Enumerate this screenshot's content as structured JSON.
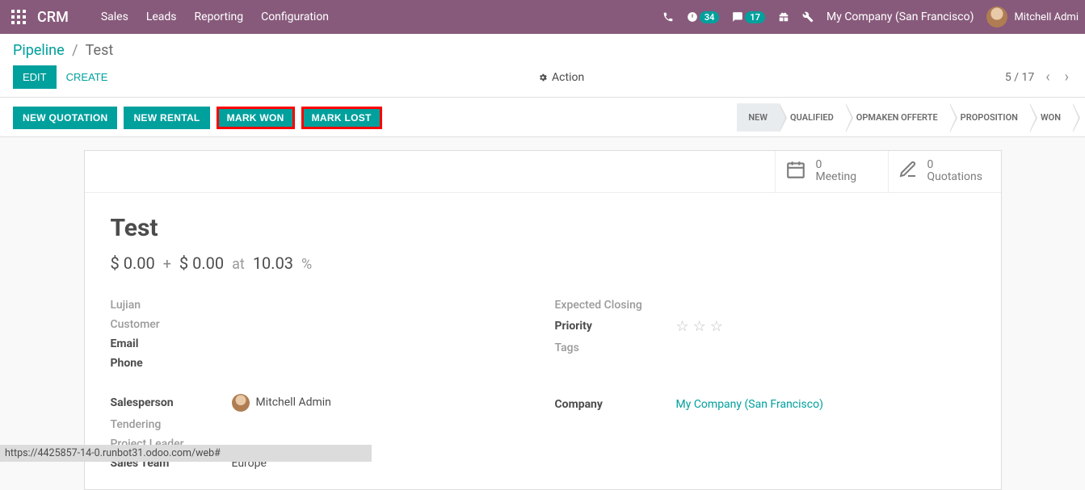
{
  "navbar": {
    "brand": "CRM",
    "menu": [
      "Sales",
      "Leads",
      "Reporting",
      "Configuration"
    ],
    "activity_count": "34",
    "msg_count": "17",
    "company": "My Company (San Francisco)",
    "user": "Mitchell Admi"
  },
  "breadcrumb": {
    "root": "Pipeline",
    "current": "Test"
  },
  "buttons": {
    "edit": "EDIT",
    "create": "CREATE",
    "action": "Action"
  },
  "pager": {
    "text": "5 / 17"
  },
  "actions": {
    "new_quotation": "NEW QUOTATION",
    "new_rental": "NEW RENTAL",
    "mark_won": "MARK WON",
    "mark_lost": "MARK LOST"
  },
  "stages": [
    "NEW",
    "QUALIFIED",
    "OPMAKEN OFFERTE",
    "PROPOSITION",
    "WON"
  ],
  "active_stage": 0,
  "stats": {
    "meeting": {
      "count": "0",
      "label": "Meeting"
    },
    "quotations": {
      "count": "0",
      "label": "Quotations"
    }
  },
  "record": {
    "title": "Test",
    "revenue1": "$ 0.00",
    "revenue2": "$ 0.00",
    "at": "at",
    "probability": "10.03",
    "pct": "%"
  },
  "left_fields": {
    "lujian": "Lujian",
    "customer": "Customer",
    "email": "Email",
    "phone": "Phone",
    "salesperson": "Salesperson",
    "salesperson_val": "Mitchell Admin",
    "tendering": "Tendering",
    "project_leader": "Project Leader",
    "sales_team": "Sales Team",
    "sales_team_val": "Europe"
  },
  "right_fields": {
    "expected_closing": "Expected Closing",
    "priority": "Priority",
    "tags": "Tags",
    "company": "Company",
    "company_val": "My Company (San Francisco)"
  },
  "status_url": "https://4425857-14-0.runbot31.odoo.com/web#"
}
